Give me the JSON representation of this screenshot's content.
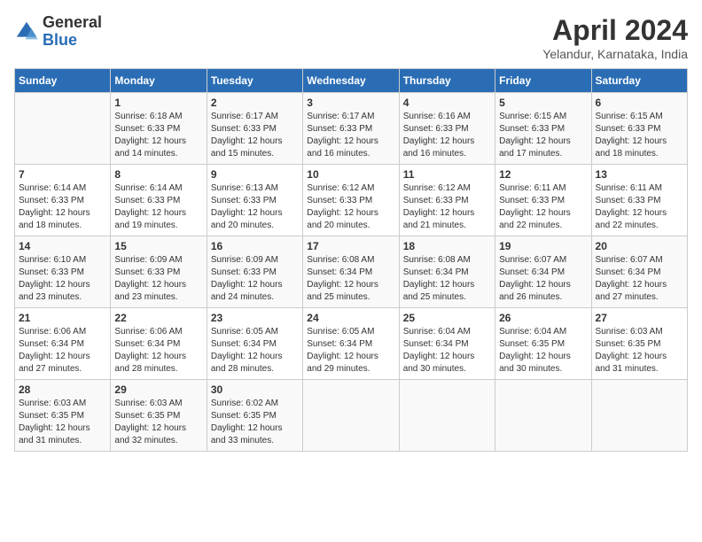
{
  "header": {
    "logo": {
      "line1": "General",
      "line2": "Blue"
    },
    "title": "April 2024",
    "location": "Yelandur, Karnataka, India"
  },
  "calendar": {
    "days_of_week": [
      "Sunday",
      "Monday",
      "Tuesday",
      "Wednesday",
      "Thursday",
      "Friday",
      "Saturday"
    ],
    "weeks": [
      [
        {
          "day": "",
          "info": ""
        },
        {
          "day": "1",
          "info": "Sunrise: 6:18 AM\nSunset: 6:33 PM\nDaylight: 12 hours\nand 14 minutes."
        },
        {
          "day": "2",
          "info": "Sunrise: 6:17 AM\nSunset: 6:33 PM\nDaylight: 12 hours\nand 15 minutes."
        },
        {
          "day": "3",
          "info": "Sunrise: 6:17 AM\nSunset: 6:33 PM\nDaylight: 12 hours\nand 16 minutes."
        },
        {
          "day": "4",
          "info": "Sunrise: 6:16 AM\nSunset: 6:33 PM\nDaylight: 12 hours\nand 16 minutes."
        },
        {
          "day": "5",
          "info": "Sunrise: 6:15 AM\nSunset: 6:33 PM\nDaylight: 12 hours\nand 17 minutes."
        },
        {
          "day": "6",
          "info": "Sunrise: 6:15 AM\nSunset: 6:33 PM\nDaylight: 12 hours\nand 18 minutes."
        }
      ],
      [
        {
          "day": "7",
          "info": "Sunrise: 6:14 AM\nSunset: 6:33 PM\nDaylight: 12 hours\nand 18 minutes."
        },
        {
          "day": "8",
          "info": "Sunrise: 6:14 AM\nSunset: 6:33 PM\nDaylight: 12 hours\nand 19 minutes."
        },
        {
          "day": "9",
          "info": "Sunrise: 6:13 AM\nSunset: 6:33 PM\nDaylight: 12 hours\nand 20 minutes."
        },
        {
          "day": "10",
          "info": "Sunrise: 6:12 AM\nSunset: 6:33 PM\nDaylight: 12 hours\nand 20 minutes."
        },
        {
          "day": "11",
          "info": "Sunrise: 6:12 AM\nSunset: 6:33 PM\nDaylight: 12 hours\nand 21 minutes."
        },
        {
          "day": "12",
          "info": "Sunrise: 6:11 AM\nSunset: 6:33 PM\nDaylight: 12 hours\nand 22 minutes."
        },
        {
          "day": "13",
          "info": "Sunrise: 6:11 AM\nSunset: 6:33 PM\nDaylight: 12 hours\nand 22 minutes."
        }
      ],
      [
        {
          "day": "14",
          "info": "Sunrise: 6:10 AM\nSunset: 6:33 PM\nDaylight: 12 hours\nand 23 minutes."
        },
        {
          "day": "15",
          "info": "Sunrise: 6:09 AM\nSunset: 6:33 PM\nDaylight: 12 hours\nand 23 minutes."
        },
        {
          "day": "16",
          "info": "Sunrise: 6:09 AM\nSunset: 6:33 PM\nDaylight: 12 hours\nand 24 minutes."
        },
        {
          "day": "17",
          "info": "Sunrise: 6:08 AM\nSunset: 6:34 PM\nDaylight: 12 hours\nand 25 minutes."
        },
        {
          "day": "18",
          "info": "Sunrise: 6:08 AM\nSunset: 6:34 PM\nDaylight: 12 hours\nand 25 minutes."
        },
        {
          "day": "19",
          "info": "Sunrise: 6:07 AM\nSunset: 6:34 PM\nDaylight: 12 hours\nand 26 minutes."
        },
        {
          "day": "20",
          "info": "Sunrise: 6:07 AM\nSunset: 6:34 PM\nDaylight: 12 hours\nand 27 minutes."
        }
      ],
      [
        {
          "day": "21",
          "info": "Sunrise: 6:06 AM\nSunset: 6:34 PM\nDaylight: 12 hours\nand 27 minutes."
        },
        {
          "day": "22",
          "info": "Sunrise: 6:06 AM\nSunset: 6:34 PM\nDaylight: 12 hours\nand 28 minutes."
        },
        {
          "day": "23",
          "info": "Sunrise: 6:05 AM\nSunset: 6:34 PM\nDaylight: 12 hours\nand 28 minutes."
        },
        {
          "day": "24",
          "info": "Sunrise: 6:05 AM\nSunset: 6:34 PM\nDaylight: 12 hours\nand 29 minutes."
        },
        {
          "day": "25",
          "info": "Sunrise: 6:04 AM\nSunset: 6:34 PM\nDaylight: 12 hours\nand 30 minutes."
        },
        {
          "day": "26",
          "info": "Sunrise: 6:04 AM\nSunset: 6:35 PM\nDaylight: 12 hours\nand 30 minutes."
        },
        {
          "day": "27",
          "info": "Sunrise: 6:03 AM\nSunset: 6:35 PM\nDaylight: 12 hours\nand 31 minutes."
        }
      ],
      [
        {
          "day": "28",
          "info": "Sunrise: 6:03 AM\nSunset: 6:35 PM\nDaylight: 12 hours\nand 31 minutes."
        },
        {
          "day": "29",
          "info": "Sunrise: 6:03 AM\nSunset: 6:35 PM\nDaylight: 12 hours\nand 32 minutes."
        },
        {
          "day": "30",
          "info": "Sunrise: 6:02 AM\nSunset: 6:35 PM\nDaylight: 12 hours\nand 33 minutes."
        },
        {
          "day": "",
          "info": ""
        },
        {
          "day": "",
          "info": ""
        },
        {
          "day": "",
          "info": ""
        },
        {
          "day": "",
          "info": ""
        }
      ]
    ]
  }
}
